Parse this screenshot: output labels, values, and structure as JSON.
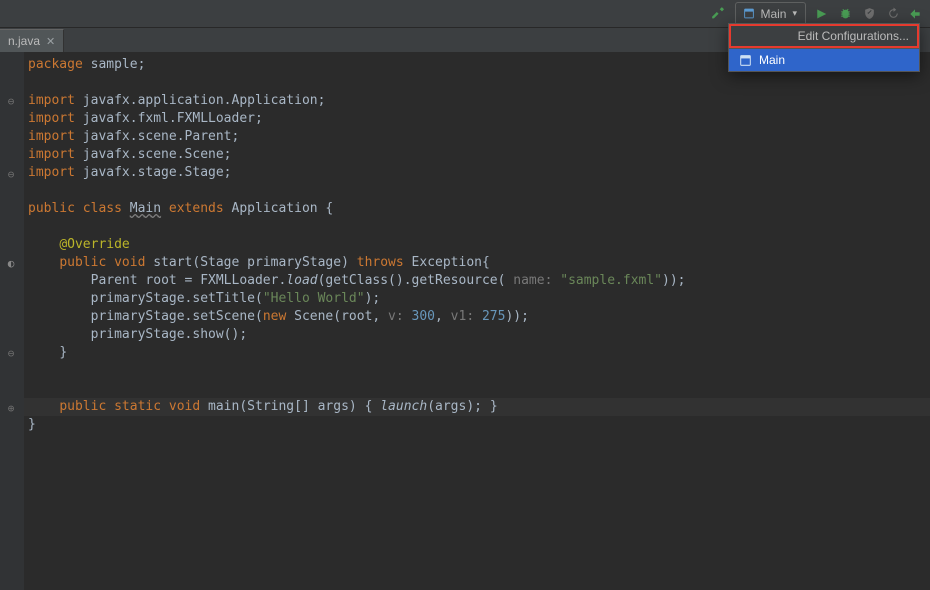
{
  "toolbar": {
    "run_config_label": "Main"
  },
  "dropdown": {
    "edit_label": "Edit Configurations...",
    "items": [
      {
        "label": "Main",
        "selected": true
      }
    ]
  },
  "tabs": [
    {
      "label": "n.java"
    }
  ],
  "code": {
    "l1_kw": "package",
    "l1_rest": " sample;",
    "l3_kw": "import",
    "l3_rest": " javafx.application.Application;",
    "l4_kw": "import",
    "l4_rest": " javafx.fxml.FXMLLoader;",
    "l5_kw": "import",
    "l5_rest": " javafx.scene.Parent;",
    "l6_kw": "import",
    "l6_rest": " javafx.scene.Scene;",
    "l7_kw": "import",
    "l7_rest": " javafx.stage.Stage;",
    "l9_a": "public class ",
    "l9_main": "Main",
    "l9_b": " extends ",
    "l9_c": "Application {",
    "l11": "@Override",
    "l12_a": "public void ",
    "l12_b": "start",
    "l12_c": "(Stage primaryStage) ",
    "l12_d": "throws ",
    "l12_e": "Exception{",
    "l13_a": "Parent root = FXMLLoader.",
    "l13_b": "load",
    "l13_c": "(getClass().getResource(",
    "l13_h": " name: ",
    "l13_s": "\"sample.fxml\"",
    "l13_d": "));",
    "l14_a": "primaryStage.setTitle(",
    "l14_s": "\"Hello World\"",
    "l14_b": ");",
    "l15_a": "primaryStage.setScene(",
    "l15_b": "new ",
    "l15_c": "Scene(root,",
    "l15_h1": " v: ",
    "l15_n1": "300",
    "l15_d": ",",
    "l15_h2": " v1: ",
    "l15_n2": "275",
    "l15_e": "));",
    "l16": "primaryStage.show();",
    "l17": "}",
    "l20_a": "public static void ",
    "l20_b": "main",
    "l20_c": "(String[] args) { ",
    "l20_d": "launch",
    "l20_e": "(args); ",
    "l20_f": "}",
    "l21": "}"
  }
}
